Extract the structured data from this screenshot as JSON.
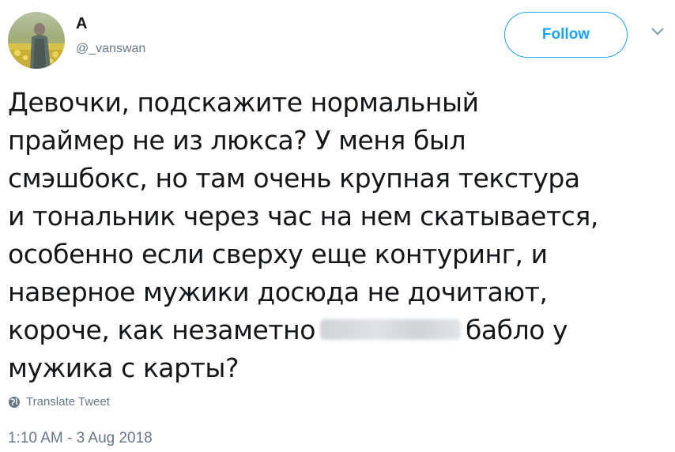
{
  "author": {
    "display_name": "A",
    "screen_name": "@_vanswan"
  },
  "follow_button": {
    "label": "Follow"
  },
  "tweet": {
    "lines": [
      "Девочки, подскажите нормальный",
      "праймер не из люкса? У меня был",
      "смэшбокс,  но там очень крупная текстура",
      "и тональник через час на нем скатывается,",
      "особенно если сверху еще контуринг, и",
      "наверное мужики досюда не  дочитают,",
      "короче, как незаметно",
      "бабло у",
      "мужика с карты?"
    ]
  },
  "translate_label": "Translate Tweet",
  "timestamp": "1:10 AM - 3 Aug 2018",
  "colors": {
    "accent": "#1da1f2",
    "secondary_text": "#657786",
    "primary_text": "#14171a"
  },
  "icons": {
    "caret": "chevron-down-icon",
    "translate": "globe-icon"
  }
}
